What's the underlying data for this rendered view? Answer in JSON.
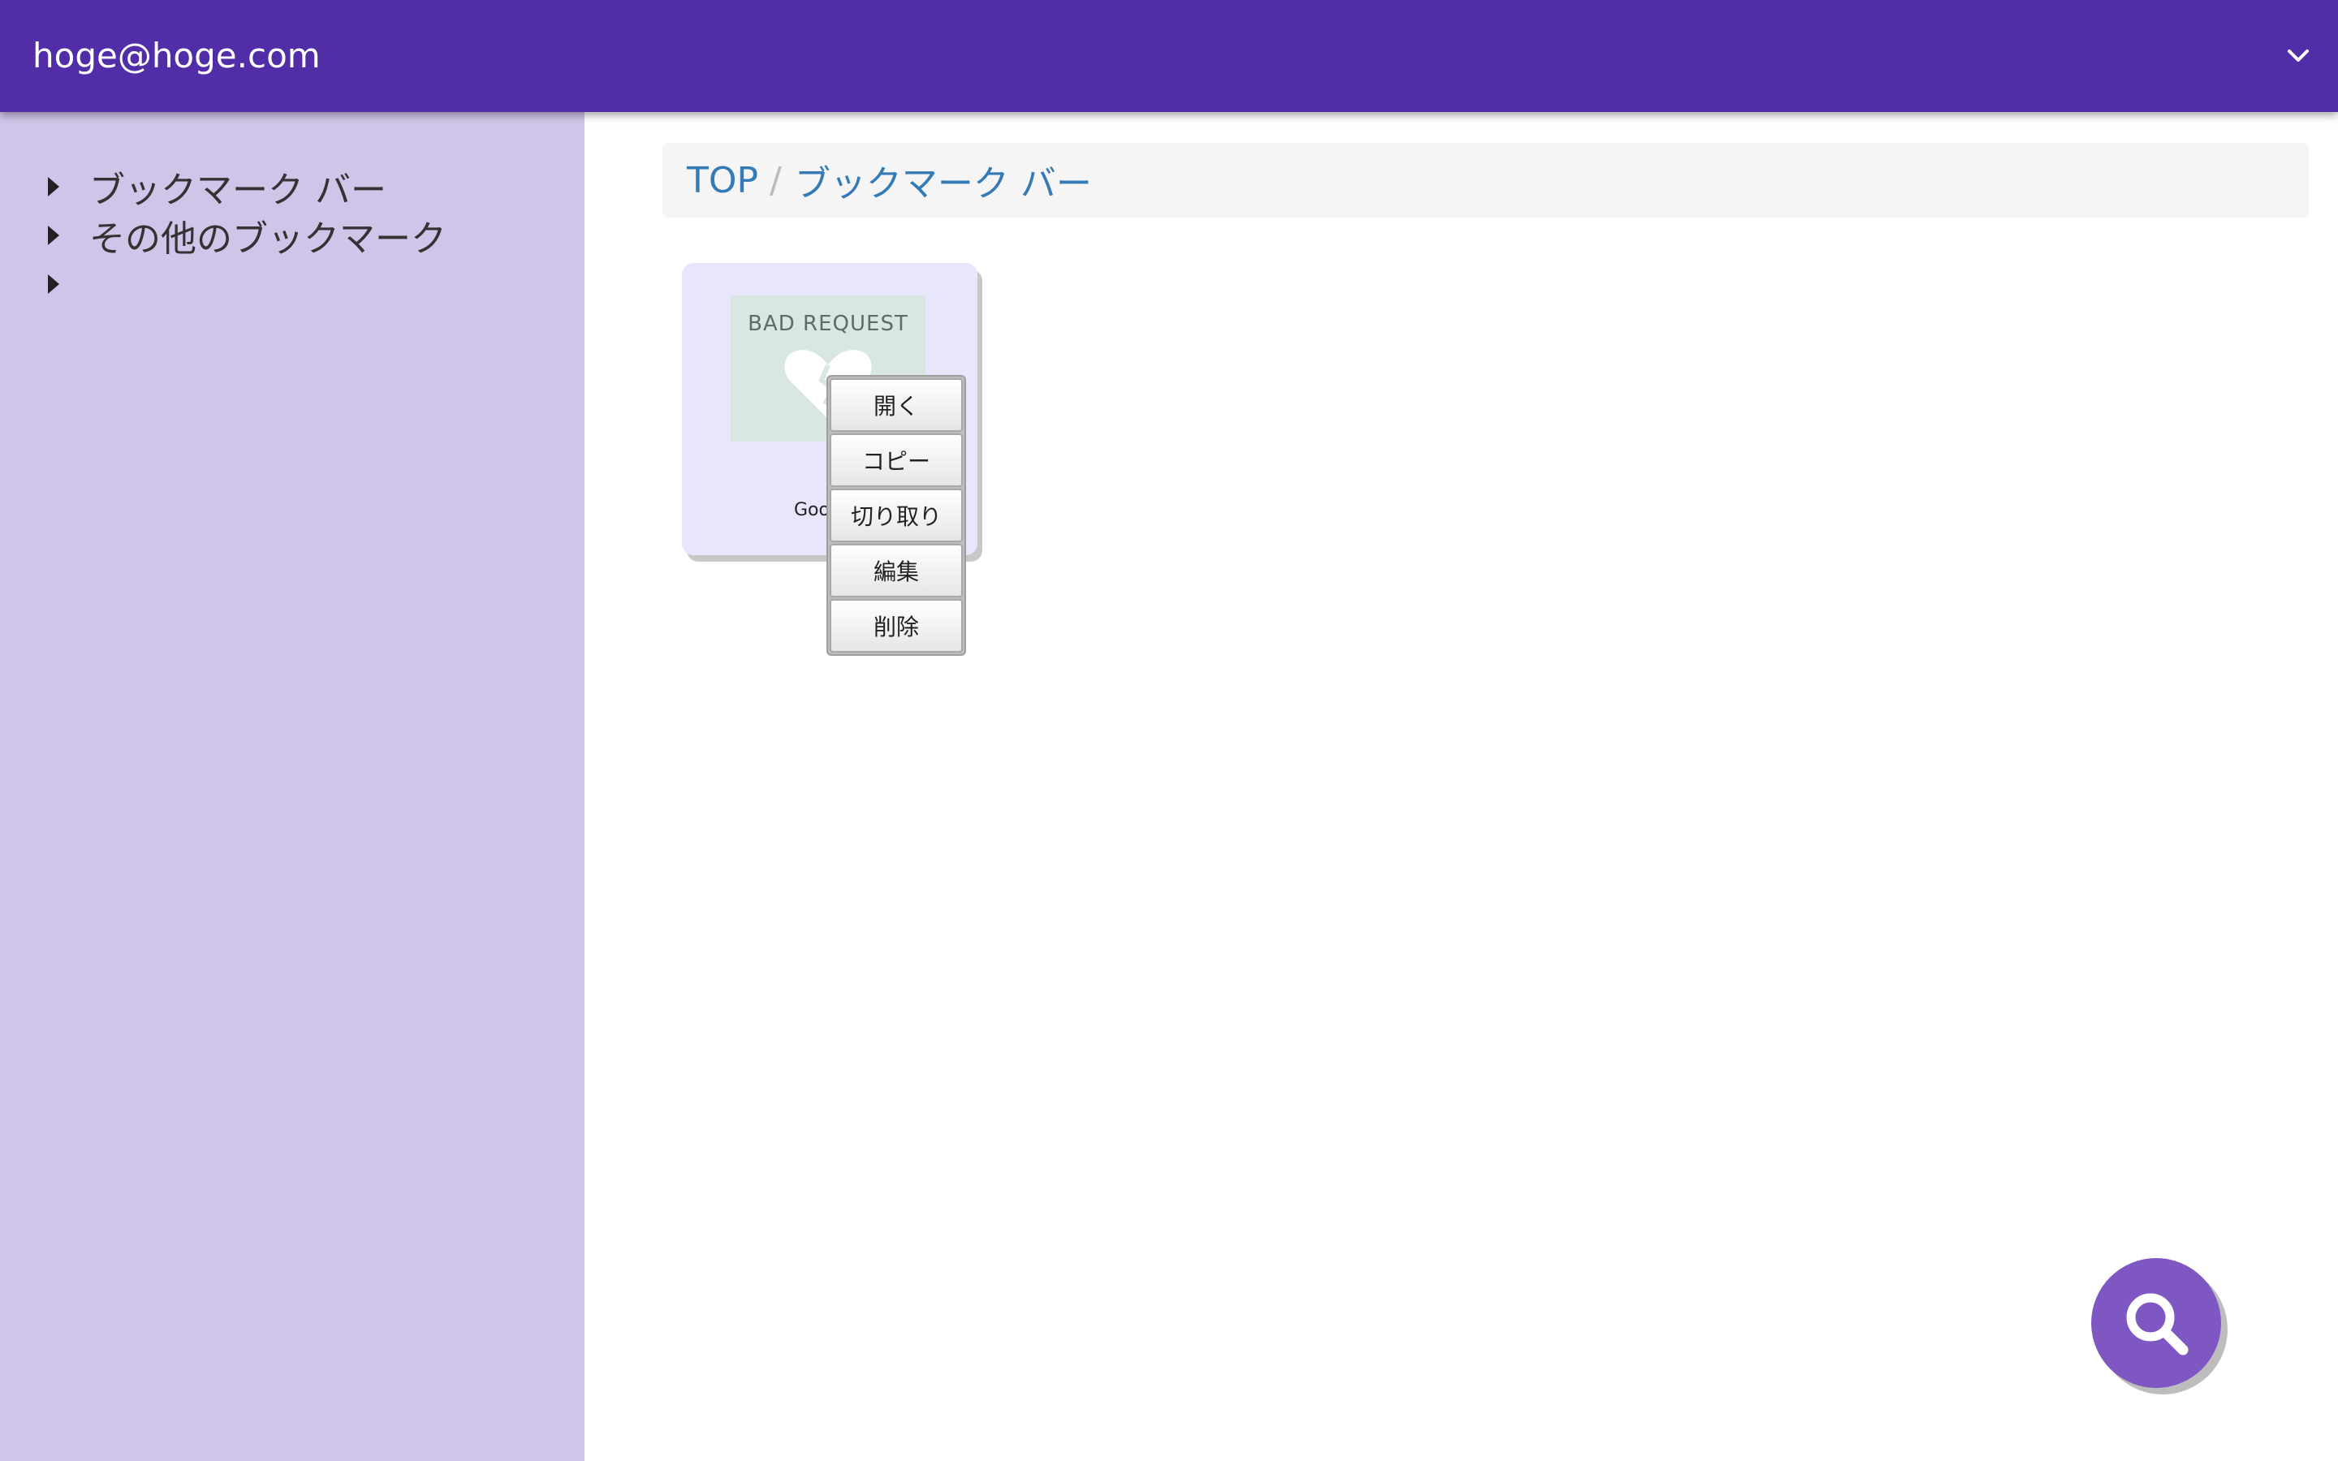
{
  "header": {
    "account": "hoge@hoge.com",
    "dropdown_icon": "chevron-down-icon",
    "background": "#512DA8"
  },
  "sidebar": {
    "background": "#D1C4E9",
    "items": [
      {
        "label": "ブックマーク バー"
      },
      {
        "label": "その他のブックマーク"
      },
      {
        "label": ""
      }
    ]
  },
  "breadcrumb": {
    "items": [
      {
        "label": "TOP"
      },
      {
        "label": "ブックマーク バー"
      }
    ],
    "separator": "/"
  },
  "bookmark": {
    "thumbnail_text": "BAD REQUEST",
    "title": "Goo"
  },
  "context_menu": {
    "items": [
      {
        "label": "開く"
      },
      {
        "label": "コピー"
      },
      {
        "label": "切り取り"
      },
      {
        "label": "編集"
      },
      {
        "label": "削除"
      }
    ]
  },
  "fab": {
    "icon": "search-icon",
    "color": "#7E57C2"
  }
}
